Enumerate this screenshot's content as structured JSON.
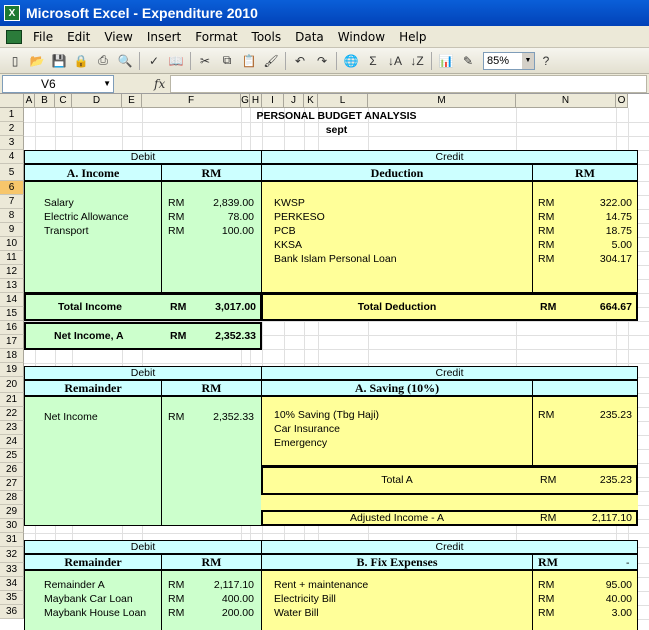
{
  "window": {
    "title": "Microsoft Excel - Expenditure 2010"
  },
  "menu": [
    "File",
    "Edit",
    "View",
    "Insert",
    "Format",
    "Tools",
    "Data",
    "Window",
    "Help"
  ],
  "toolbar": {
    "zoom": "85%"
  },
  "formula": {
    "cell_ref": "V6",
    "fx": "fx"
  },
  "columns": [
    "A",
    "B",
    "C",
    "D",
    "E",
    "F",
    "G",
    "H",
    "I",
    "J",
    "K",
    "L",
    "M",
    "N",
    "O"
  ],
  "rows": [
    "1",
    "2",
    "3",
    "4",
    "5",
    "6",
    "7",
    "8",
    "9",
    "10",
    "11",
    "12",
    "13",
    "14",
    "15",
    "16",
    "17",
    "18",
    "19",
    "20",
    "21",
    "22",
    "23",
    "24",
    "25",
    "26",
    "27",
    "28",
    "29",
    "30",
    "31",
    "32",
    "33",
    "34",
    "35",
    "36"
  ],
  "sheet": {
    "title": "PERSONAL BUDGET ANALYSIS",
    "subtitle": "sept",
    "s1": {
      "debit": "Debit",
      "credit": "Credit",
      "income_hdr": "A. Income",
      "rm_hdr": "RM",
      "deduction_hdr": "Deduction",
      "rm_hdr2": "RM",
      "income": [
        {
          "label": "Salary",
          "cur": "RM",
          "val": "2,839.00"
        },
        {
          "label": "Electric Allowance",
          "cur": "RM",
          "val": "78.00"
        },
        {
          "label": "Transport",
          "cur": "RM",
          "val": "100.00"
        }
      ],
      "deductions": [
        {
          "label": "KWSP",
          "cur": "RM",
          "val": "322.00"
        },
        {
          "label": "PERKESO",
          "cur": "RM",
          "val": "14.75"
        },
        {
          "label": "PCB",
          "cur": "RM",
          "val": "18.75"
        },
        {
          "label": "KKSA",
          "cur": "RM",
          "val": "5.00"
        },
        {
          "label": "Bank Islam Personal Loan",
          "cur": "RM",
          "val": "304.17"
        }
      ],
      "total_income": {
        "label": "Total Income",
        "cur": "RM",
        "val": "3,017.00"
      },
      "total_deduction": {
        "label": "Total Deduction",
        "cur": "RM",
        "val": "664.67"
      },
      "net_income": {
        "label": "Net Income, A",
        "cur": "RM",
        "val": "2,352.33"
      }
    },
    "s2": {
      "debit": "Debit",
      "credit": "Credit",
      "remainder_hdr": "Remainder",
      "rm_hdr": "RM",
      "saving_hdr": "A. Saving (10%)",
      "net": {
        "label": "Net Income",
        "cur": "RM",
        "val": "2,352.33"
      },
      "savings": [
        {
          "label": "10% Saving (Tbg Haji)",
          "cur": "RM",
          "val": "235.23"
        },
        {
          "label": "Car Insurance",
          "cur": "",
          "val": ""
        },
        {
          "label": "Emergency",
          "cur": "",
          "val": ""
        }
      ],
      "total_a": {
        "label": "Total A",
        "cur": "RM",
        "val": "235.23"
      },
      "adjusted": {
        "label": "Adjusted Income  - A",
        "cur": "RM",
        "val": "2,117.10"
      }
    },
    "s3": {
      "debit": "Debit",
      "credit": "Credit",
      "remainder_hdr": "Remainder",
      "rm_hdr": "RM",
      "fix_hdr": "B. Fix Expenses",
      "rm_hdr2": "RM",
      "dash": "-",
      "remainder": [
        {
          "label": "Remainder A",
          "cur": "RM",
          "val": "2,117.10"
        },
        {
          "label": "Maybank Car Loan",
          "cur": "RM",
          "val": "400.00"
        },
        {
          "label": "Maybank House Loan",
          "cur": "RM",
          "val": "200.00"
        }
      ],
      "fix": [
        {
          "label": "Rent + maintenance",
          "cur": "RM",
          "val": "95.00"
        },
        {
          "label": "Electricity Bill",
          "cur": "RM",
          "val": "40.00"
        },
        {
          "label": "Water Bill",
          "cur": "RM",
          "val": "3.00"
        }
      ]
    }
  }
}
